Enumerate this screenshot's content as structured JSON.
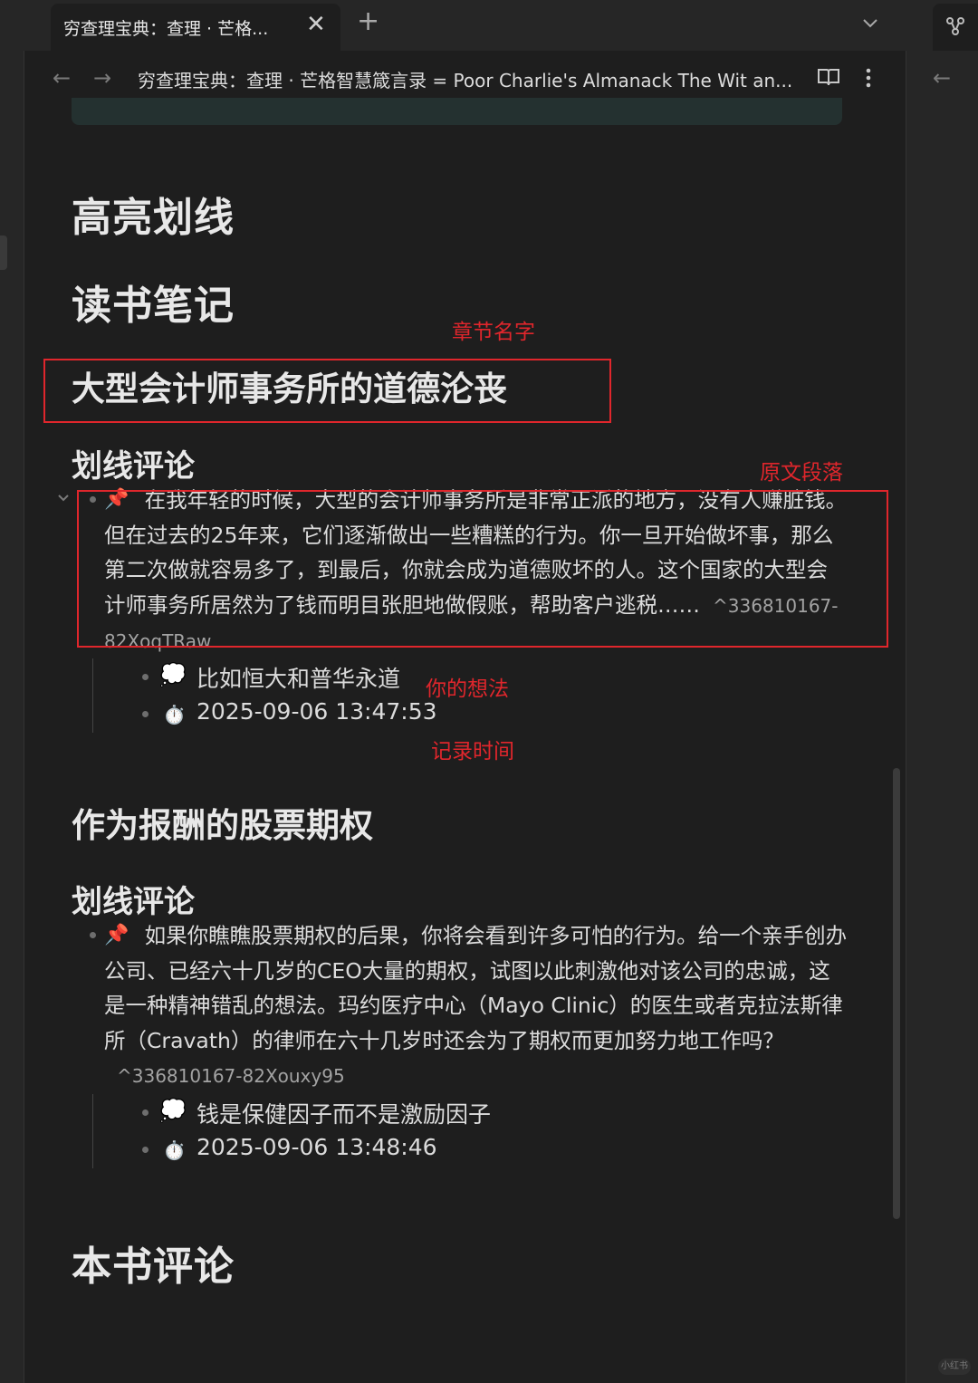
{
  "tabs": {
    "active_title": "穷查理宝典：查理 · 芒格...",
    "close_glyph": "✕",
    "new_tab_glyph": "+"
  },
  "nav": {
    "back_glyph": "←",
    "forward_glyph": "→",
    "breadcrumb": "穷查理宝典：查理 · 芒格智慧箴言录 = Poor Charlie's Almanack The Wit an..."
  },
  "doc": {
    "heading_highlights": "高亮划线",
    "heading_notes": "读书笔记",
    "chapters": [
      {
        "title": "大型会计师事务所的道德沦丧",
        "subheading": "划线评论",
        "quote_icon": "📌",
        "quote": "在我年轻的时候，大型的会计师事务所是非常正派的地方，没有人赚脏钱。但在过去的25年来，它们逐渐做出一些糟糕的行为。你一旦开始做坏事，那么第二次做就容易多了，到最后，你就会成为道德败坏的人。这个国家的大型会计师事务所居然为了钱而明目张胆地做假账，帮助客户逃税……",
        "block_id": "^336810167-82XoqTRaw",
        "thought_icon": "💭",
        "thought": "比如恒大和普华永道",
        "time_icon": "⏱️",
        "timestamp": "2025-09-06 13:47:53"
      },
      {
        "title": "作为报酬的股票期权",
        "subheading": "划线评论",
        "quote_icon": "📌",
        "quote": "如果你瞧瞧股票期权的后果，你将会看到许多可怕的行为。给一个亲手创办公司、已经六十几岁的CEO大量的期权，试图以此刺激他对该公司的忠诚，这是一种精神错乱的想法。玛约医疗中心（Mayo Clinic）的医生或者克拉法斯律所（Cravath）的律师在六十几岁时还会为了期权而更加努力地工作吗？",
        "block_id": "^336810167-82Xouxy95",
        "thought_icon": "💭",
        "thought": "钱是保健因子而不是激励因子",
        "time_icon": "⏱️",
        "timestamp": "2025-09-06 13:48:46"
      }
    ],
    "heading_review": "本书评论"
  },
  "annotations": {
    "chapter_name": "章节名字",
    "original_paragraph": "原文段落",
    "your_thought": "你的想法",
    "record_time": "记录时间"
  },
  "colors": {
    "annotation_red": "#e0262c",
    "background": "#1e1e1e"
  },
  "watermark": "小红书"
}
